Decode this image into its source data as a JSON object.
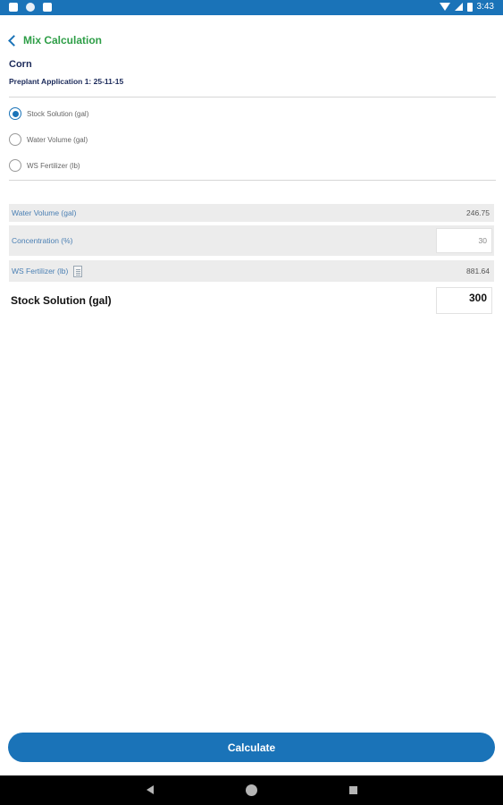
{
  "status_bar": {
    "time": "3:43",
    "icons": [
      "notification-icon",
      "sync-icon",
      "sd-card-icon",
      "wifi-icon",
      "signal-icon",
      "battery-icon"
    ]
  },
  "header": {
    "back_label": "Mix Calculation"
  },
  "crop": {
    "name": "Corn",
    "application": "Preplant Application 1: 25-11-15"
  },
  "options": [
    {
      "label": "Stock Solution (gal)",
      "selected": true
    },
    {
      "label": "Water Volume (gal)",
      "selected": false
    },
    {
      "label": "WS Fertilizer (lb)",
      "selected": false
    }
  ],
  "fields": {
    "water_volume": {
      "label": "Water Volume (gal)",
      "value": "246.75"
    },
    "concentration": {
      "label": "Concentration (%)",
      "value": "30"
    },
    "ws_fertilizer": {
      "label": "WS Fertilizer (lb)",
      "value": "881.64"
    },
    "stock_solution": {
      "label": "Stock Solution (gal)",
      "value": "300"
    }
  },
  "actions": {
    "calculate_label": "Calculate"
  },
  "colors": {
    "primary": "#1a73b8",
    "back_label": "#2e9e47",
    "heading": "#1b2a5a",
    "field_label": "#4a7fb3"
  }
}
